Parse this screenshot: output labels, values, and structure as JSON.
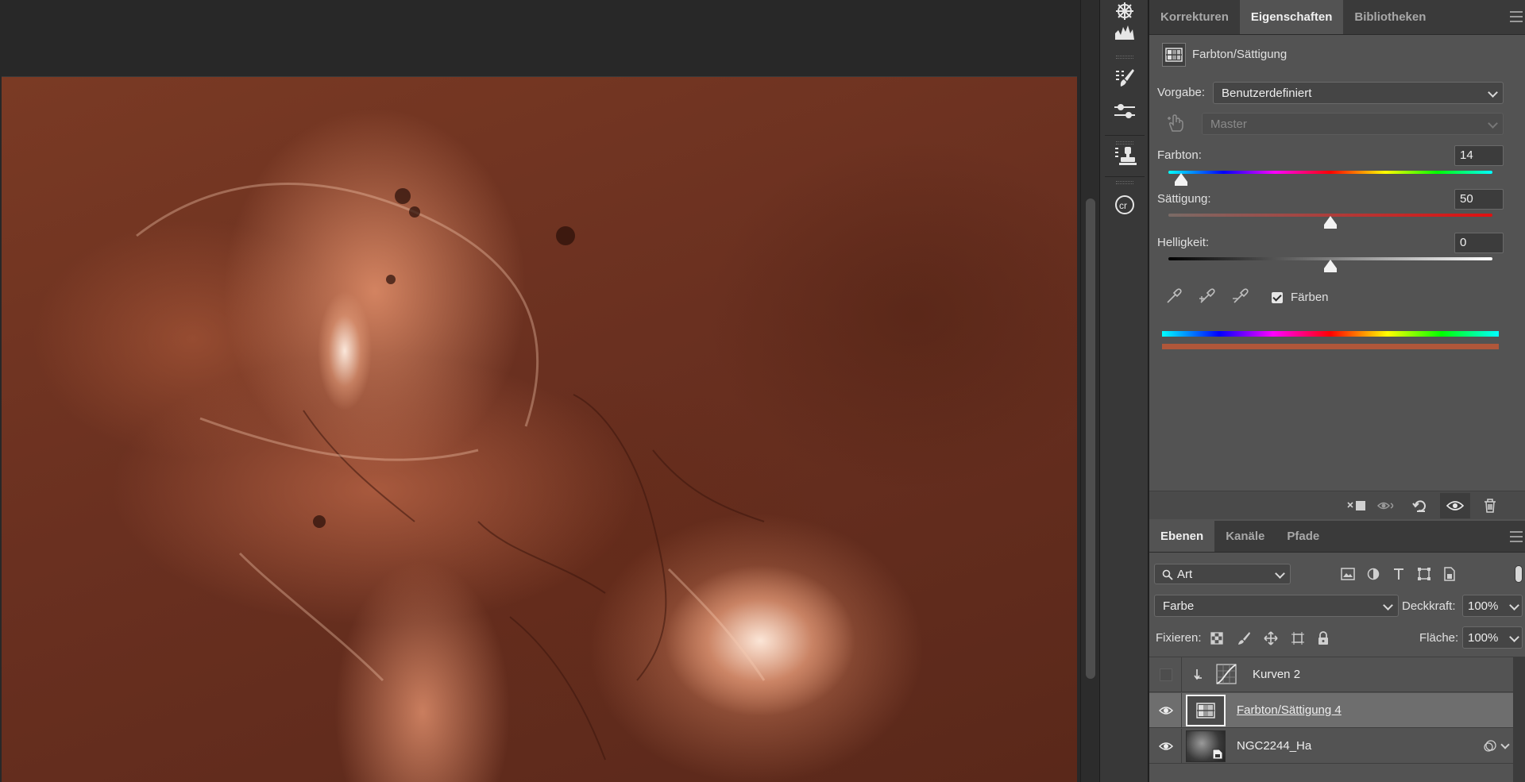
{
  "canvas": {
    "image_name": "NGC2244_Ha"
  },
  "properties_panel": {
    "tabs": [
      {
        "label": "Korrekturen",
        "active": false
      },
      {
        "label": "Eigenschaften",
        "active": true
      },
      {
        "label": "Bibliotheken",
        "active": false
      }
    ],
    "adjustment_title": "Farbton/Sättigung",
    "preset_label": "Vorgabe:",
    "preset_value": "Benutzerdefiniert",
    "channel_value": "Master",
    "hue": {
      "label": "Farbton:",
      "value": "14"
    },
    "saturation": {
      "label": "Sättigung:",
      "value": "50"
    },
    "lightness": {
      "label": "Helligkeit:",
      "value": "0"
    },
    "colorize": {
      "label": "Färben",
      "checked": true
    },
    "slider_ranges": {
      "hue": [
        -180,
        180
      ],
      "saturation": [
        -100,
        100
      ],
      "lightness": [
        -100,
        100
      ]
    },
    "colors": {
      "colorize_bar": "#b0573a"
    }
  },
  "layers_panel": {
    "tabs": [
      {
        "label": "Ebenen",
        "active": true
      },
      {
        "label": "Kanäle",
        "active": false
      },
      {
        "label": "Pfade",
        "active": false
      }
    ],
    "filter_value": "Art",
    "blend_mode": "Farbe",
    "opacity_label": "Deckkraft:",
    "opacity_value": "100%",
    "lock_label": "Fixieren:",
    "fill_label": "Fläche:",
    "fill_value": "100%",
    "layers": [
      {
        "name": "Kurven 2",
        "visible": false,
        "selected": false,
        "type": "curves",
        "clipped": true
      },
      {
        "name": "Farbton/Sättigung 4",
        "visible": true,
        "selected": true,
        "type": "hue-saturation",
        "clipped": false
      },
      {
        "name": "NGC2244_Ha",
        "visible": true,
        "selected": false,
        "type": "smart-object",
        "clipped": false
      }
    ]
  }
}
